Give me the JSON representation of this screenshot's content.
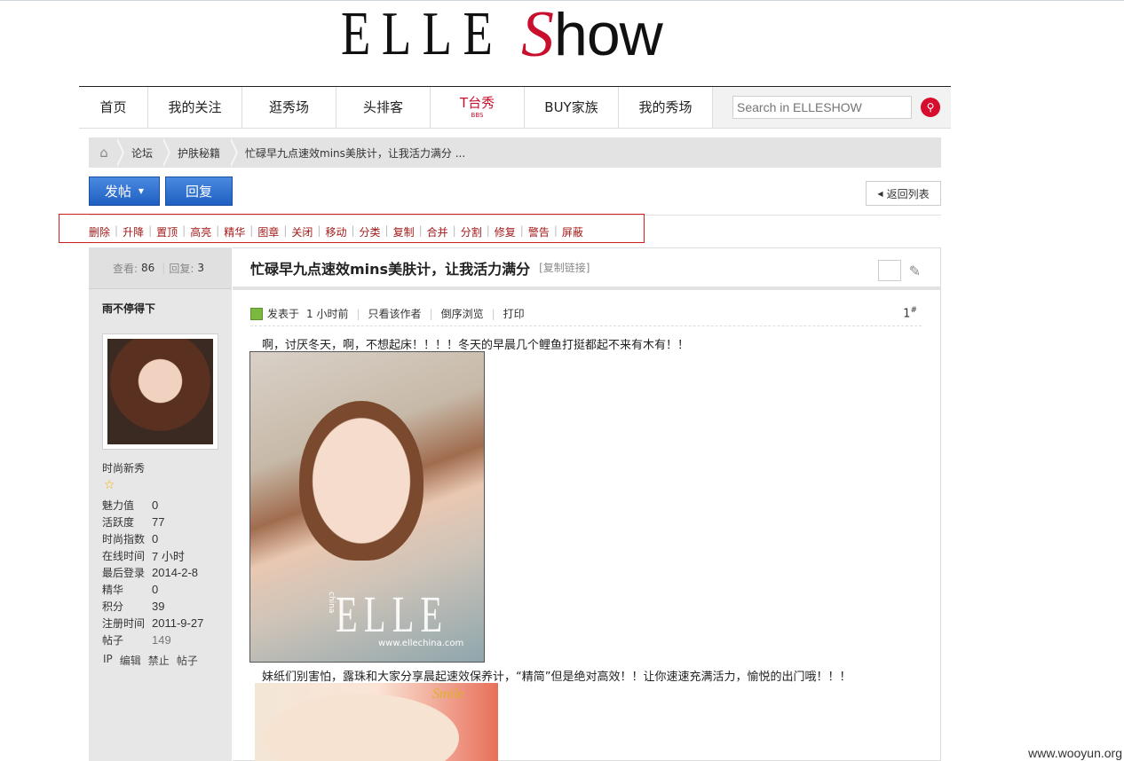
{
  "logo": {
    "elle": "ELLE",
    "s": "S",
    "how": "how"
  },
  "nav": {
    "items": [
      {
        "label": "首页",
        "sub": ""
      },
      {
        "label": "我的关注",
        "sub": ""
      },
      {
        "label": "逛秀场",
        "sub": ""
      },
      {
        "label": "头排客",
        "sub": ""
      },
      {
        "label": "T台秀",
        "sub": "BBS"
      },
      {
        "label": "BUY家族",
        "sub": ""
      },
      {
        "label": "我的秀场",
        "sub": ""
      }
    ],
    "search_placeholder": "Search in ELLESHOW",
    "search_icon": "search-icon"
  },
  "breadcrumb": {
    "home_icon": "home-icon",
    "items": [
      "论坛",
      "护肤秘籍",
      "忙碌早九点速效mins美肤计，让我活力满分 ..."
    ]
  },
  "actions": {
    "post": "发帖",
    "reply": "回复",
    "back": "返回列表"
  },
  "mod_links": [
    "删除",
    "升降",
    "置顶",
    "高亮",
    "精华",
    "图章",
    "关闭",
    "移动",
    "分类",
    "复制",
    "合并",
    "分割",
    "修复",
    "警告",
    "屏蔽"
  ],
  "sidebar": {
    "views_label": "查看:",
    "views": "86",
    "replies_label": "回复:",
    "replies": "3",
    "username": "雨不停得下",
    "rank": "时尚新秀",
    "rank_icon": "star-icon",
    "profile": [
      {
        "k": "魅力值",
        "v": "0"
      },
      {
        "k": "活跃度",
        "v": "77"
      },
      {
        "k": "时尚指数",
        "v": "0"
      },
      {
        "k": "在线时间",
        "v": "7 小时"
      },
      {
        "k": "最后登录",
        "v": "2014-2-8"
      },
      {
        "k": "精华",
        "v": "0"
      },
      {
        "k": "积分",
        "v": "39"
      },
      {
        "k": "注册时间",
        "v": "2011-9-27"
      },
      {
        "k": "帖子",
        "v": "149"
      }
    ],
    "ops": [
      "IP",
      "编辑",
      "禁止",
      "帖子"
    ]
  },
  "post": {
    "title": "忙碌早九点速效mins美肤计，让我活力满分",
    "copy_link": "[复制链接]",
    "posted_label": "发表于",
    "posted_time": "1 小时前",
    "only_author": "只看该作者",
    "reverse": "倒序浏览",
    "print": "打印",
    "floor": "1",
    "floor_mark": "#",
    "para1": "啊，讨厌冬天，啊，不想起床！！！！冬天的早晨几个鲤鱼打挺都起不来有木有！！",
    "img1_watermark": "ELLE",
    "img1_china": "china",
    "img1_url": "www.ellechina.com",
    "para2": "妹纸们别害怕，露珠和大家分享晨起速效保养计，“精简”但是绝对高效！！让你速速充满活力，愉悦的出门哦！！！",
    "img2_text": "Smile"
  },
  "watermark": "www.wooyun.org"
}
